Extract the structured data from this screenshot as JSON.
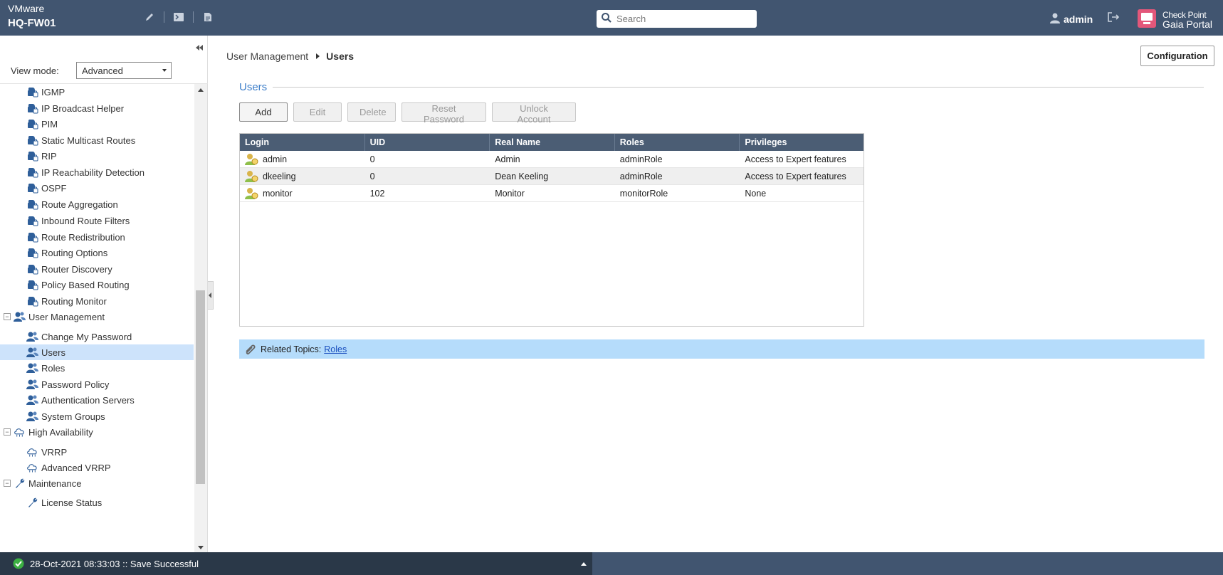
{
  "header": {
    "platform": "VMware",
    "hostname": "HQ-FW01",
    "search_placeholder": "Search",
    "user": "admin",
    "brand_line1": "Check Point",
    "brand_line2": "Gaia Portal"
  },
  "sidebar": {
    "view_mode_label": "View mode:",
    "view_mode_value": "Advanced",
    "items": [
      {
        "label": "IGMP",
        "type": "child",
        "icon": "lock-icon"
      },
      {
        "label": "IP Broadcast Helper",
        "type": "child",
        "icon": "lock-icon"
      },
      {
        "label": "PIM",
        "type": "child",
        "icon": "lock-icon"
      },
      {
        "label": "Static Multicast Routes",
        "type": "child",
        "icon": "lock-icon"
      },
      {
        "label": "RIP",
        "type": "child",
        "icon": "lock-icon"
      },
      {
        "label": "IP Reachability Detection",
        "type": "child",
        "icon": "lock-icon"
      },
      {
        "label": "OSPF",
        "type": "child",
        "icon": "lock-icon"
      },
      {
        "label": "Route Aggregation",
        "type": "child",
        "icon": "lock-icon"
      },
      {
        "label": "Inbound Route Filters",
        "type": "child",
        "icon": "lock-icon"
      },
      {
        "label": "Route Redistribution",
        "type": "child",
        "icon": "lock-icon"
      },
      {
        "label": "Routing Options",
        "type": "child",
        "icon": "lock-icon"
      },
      {
        "label": "Router Discovery",
        "type": "child",
        "icon": "lock-icon"
      },
      {
        "label": "Policy Based Routing",
        "type": "child",
        "icon": "lock-icon"
      },
      {
        "label": "Routing Monitor",
        "type": "child",
        "icon": "lock-icon"
      },
      {
        "label": "User Management",
        "type": "group",
        "icon": "users-icon"
      },
      {
        "label": "Change My Password",
        "type": "child",
        "icon": "users-icon"
      },
      {
        "label": "Users",
        "type": "child",
        "icon": "users-icon",
        "selected": true
      },
      {
        "label": "Roles",
        "type": "child",
        "icon": "users-icon"
      },
      {
        "label": "Password Policy",
        "type": "child",
        "icon": "users-icon"
      },
      {
        "label": "Authentication Servers",
        "type": "child",
        "icon": "users-icon"
      },
      {
        "label": "System Groups",
        "type": "child",
        "icon": "users-icon"
      },
      {
        "label": "High Availability",
        "type": "group",
        "icon": "cloud-icon"
      },
      {
        "label": "VRRP",
        "type": "child",
        "icon": "cloud-icon"
      },
      {
        "label": "Advanced VRRP",
        "type": "child",
        "icon": "cloud-icon"
      },
      {
        "label": "Maintenance",
        "type": "group",
        "icon": "wrench-icon"
      },
      {
        "label": "License Status",
        "type": "child",
        "icon": "wrench-icon"
      }
    ]
  },
  "main": {
    "breadcrumb": {
      "parent": "User Management",
      "current": "Users"
    },
    "config_button": "Configuration",
    "section_title": "Users",
    "buttons": {
      "add": "Add",
      "edit": "Edit",
      "delete": "Delete",
      "reset_password": "Reset Password",
      "unlock_account": "Unlock Account"
    },
    "table": {
      "columns": [
        "Login",
        "UID",
        "Real Name",
        "Roles",
        "Privileges"
      ],
      "rows": [
        {
          "login": "admin",
          "uid": "0",
          "real_name": "Admin",
          "roles": "adminRole",
          "privileges": "Access to Expert features"
        },
        {
          "login": "dkeeling",
          "uid": "0",
          "real_name": "Dean Keeling",
          "roles": "adminRole",
          "privileges": "Access to Expert features"
        },
        {
          "login": "monitor",
          "uid": "102",
          "real_name": "Monitor",
          "roles": "monitorRole",
          "privileges": "None"
        }
      ]
    },
    "related": {
      "label": "Related Topics:",
      "link": "Roles"
    }
  },
  "status": {
    "message": "28-Oct-2021 08:33:03 :: Save Successful"
  },
  "colors": {
    "header": "#415570",
    "accent": "#3d7ec9",
    "selected": "#cde3fb",
    "related_bg": "#b5dcfb"
  }
}
